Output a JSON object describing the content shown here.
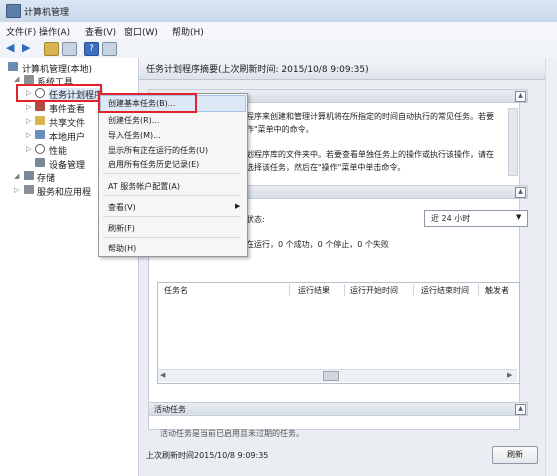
{
  "window": {
    "title": "计算机管理"
  },
  "menubar": [
    "文件(F)",
    "操作(A)",
    "查看(V)",
    "窗口(W)",
    "帮助(H)"
  ],
  "tree": {
    "root": "计算机管理(本地)",
    "system_tools": "系统工具",
    "task_scheduler": "任务计划程序",
    "event_viewer": "事件查看",
    "shared_folders": "共享文件",
    "local_users": "本地用户",
    "performance": "性能",
    "device_manager": "设备管理",
    "storage": "存储",
    "services_apps": "服务和应用程"
  },
  "pane": {
    "header": "任务计划程序摘要(上次刷新时间: 2015/10/8 9:09:35)",
    "intro_line1": "程序来创建和管理计算机将在所指定的时间自动执行的常见任务。若要",
    "intro_line2": "作\"菜单中的命令。",
    "intro_line3": "划程序库的文件夹中。若要查看单独任务上的操作或执行该操作，请在",
    "intro_line4": "选择该任务，然后在\"操作\"菜单中单击命令。",
    "status_label": "状态:",
    "status_text": "在运行，0 个成功，0 个停止，0 个失败",
    "period_value": "近 24 小时",
    "table_headers": [
      "任务名",
      "运行结果",
      "运行开始时间",
      "运行结束时间",
      "触发者"
    ],
    "active_tasks": "活动任务",
    "active_tasks_desc": "活动任务是当前已启用且未过期的任务。",
    "last_refresh": "上次刷新时间2015/10/8 9:09:35",
    "refresh_button": "刷新"
  },
  "context_menu": {
    "items": [
      "创建基本任务(B)...",
      "创建任务(R)...",
      "导入任务(M)...",
      "显示所有正在运行的任务(U)",
      "启用所有任务历史记录(E)",
      "AT 服务帐户配置(A)",
      "查看(V)",
      "刷新(F)",
      "帮助(H)"
    ]
  },
  "colors": {
    "highlight": "#e3232b",
    "accent": "#3e5d80"
  }
}
